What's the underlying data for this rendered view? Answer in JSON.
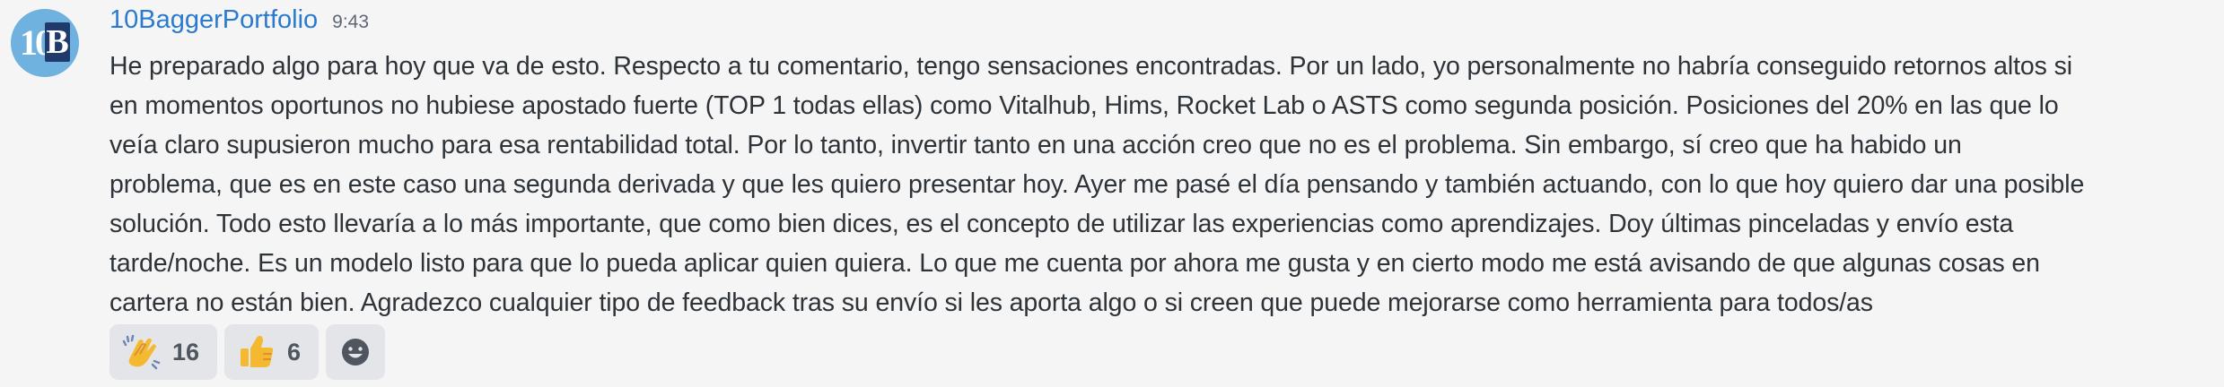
{
  "message": {
    "author": "10BaggerPortfolio",
    "timestamp": "9:43",
    "avatar_text": "10",
    "avatar_letter": "B",
    "lines": [
      "He preparado algo para hoy que va de esto. Respecto a tu comentario, tengo sensaciones encontradas. Por un lado, yo personalmente no habría conseguido retornos altos si",
      "en momentos oportunos no hubiese apostado fuerte (TOP 1 todas ellas) como Vitalhub, Hims, Rocket Lab o ASTS como segunda posición. Posiciones del 20% en las que lo",
      "veía claro supusieron mucho para esa rentabilidad total. Por lo tanto, invertir tanto en una acción creo que no es el problema. Sin embargo, sí creo que ha habido un",
      "problema, que es en este caso una segunda derivada y que les quiero presentar hoy. Ayer me pasé el día pensando y también actuando, con lo que hoy quiero dar una posible",
      "solución. Todo esto llevaría a lo más importante, que como bien dices, es el concepto de utilizar las experiencias como aprendizajes. Doy últimas pinceladas y envío esta",
      "tarde/noche. Es un modelo listo para que lo pueda aplicar quien quiera. Lo que me cuenta por ahora me gusta y en cierto modo me está avisando de que algunas cosas en",
      "cartera no están bien. Agradezco cualquier tipo de feedback tras su envío si les aporta algo o si creen que puede mejorarse como herramienta para todos/as"
    ]
  },
  "reactions": [
    {
      "icon": "clapping-hands-icon",
      "count": "16"
    },
    {
      "icon": "thumbs-up-icon",
      "count": "6"
    }
  ],
  "add_reaction": {
    "icon": "add-reaction-smiley-icon"
  },
  "colors": {
    "username": "#2a7bd0",
    "avatar_bg": "#6fb1df",
    "reaction_bg": "#e3e5e8",
    "page_bg": "#f5f5f6"
  }
}
